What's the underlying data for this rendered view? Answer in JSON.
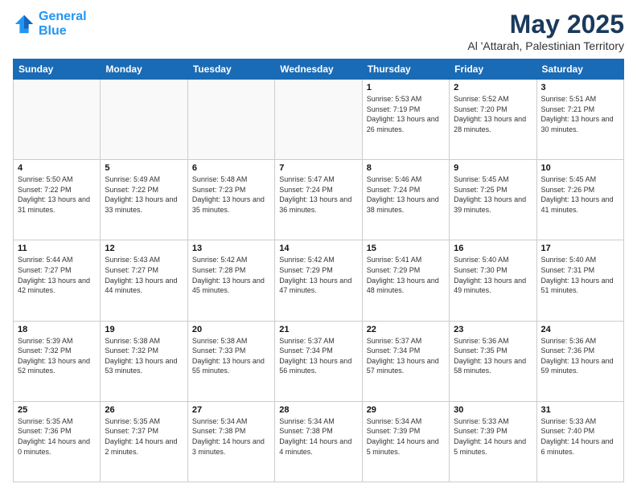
{
  "header": {
    "logo_line1": "General",
    "logo_line2": "Blue",
    "month": "May 2025",
    "location": "Al 'Attarah, Palestinian Territory"
  },
  "weekdays": [
    "Sunday",
    "Monday",
    "Tuesday",
    "Wednesday",
    "Thursday",
    "Friday",
    "Saturday"
  ],
  "weeks": [
    [
      {
        "day": "",
        "sunrise": "",
        "sunset": "",
        "daylight": ""
      },
      {
        "day": "",
        "sunrise": "",
        "sunset": "",
        "daylight": ""
      },
      {
        "day": "",
        "sunrise": "",
        "sunset": "",
        "daylight": ""
      },
      {
        "day": "",
        "sunrise": "",
        "sunset": "",
        "daylight": ""
      },
      {
        "day": "1",
        "sunrise": "Sunrise: 5:53 AM",
        "sunset": "Sunset: 7:19 PM",
        "daylight": "Daylight: 13 hours and 26 minutes."
      },
      {
        "day": "2",
        "sunrise": "Sunrise: 5:52 AM",
        "sunset": "Sunset: 7:20 PM",
        "daylight": "Daylight: 13 hours and 28 minutes."
      },
      {
        "day": "3",
        "sunrise": "Sunrise: 5:51 AM",
        "sunset": "Sunset: 7:21 PM",
        "daylight": "Daylight: 13 hours and 30 minutes."
      }
    ],
    [
      {
        "day": "4",
        "sunrise": "Sunrise: 5:50 AM",
        "sunset": "Sunset: 7:22 PM",
        "daylight": "Daylight: 13 hours and 31 minutes."
      },
      {
        "day": "5",
        "sunrise": "Sunrise: 5:49 AM",
        "sunset": "Sunset: 7:22 PM",
        "daylight": "Daylight: 13 hours and 33 minutes."
      },
      {
        "day": "6",
        "sunrise": "Sunrise: 5:48 AM",
        "sunset": "Sunset: 7:23 PM",
        "daylight": "Daylight: 13 hours and 35 minutes."
      },
      {
        "day": "7",
        "sunrise": "Sunrise: 5:47 AM",
        "sunset": "Sunset: 7:24 PM",
        "daylight": "Daylight: 13 hours and 36 minutes."
      },
      {
        "day": "8",
        "sunrise": "Sunrise: 5:46 AM",
        "sunset": "Sunset: 7:24 PM",
        "daylight": "Daylight: 13 hours and 38 minutes."
      },
      {
        "day": "9",
        "sunrise": "Sunrise: 5:45 AM",
        "sunset": "Sunset: 7:25 PM",
        "daylight": "Daylight: 13 hours and 39 minutes."
      },
      {
        "day": "10",
        "sunrise": "Sunrise: 5:45 AM",
        "sunset": "Sunset: 7:26 PM",
        "daylight": "Daylight: 13 hours and 41 minutes."
      }
    ],
    [
      {
        "day": "11",
        "sunrise": "Sunrise: 5:44 AM",
        "sunset": "Sunset: 7:27 PM",
        "daylight": "Daylight: 13 hours and 42 minutes."
      },
      {
        "day": "12",
        "sunrise": "Sunrise: 5:43 AM",
        "sunset": "Sunset: 7:27 PM",
        "daylight": "Daylight: 13 hours and 44 minutes."
      },
      {
        "day": "13",
        "sunrise": "Sunrise: 5:42 AM",
        "sunset": "Sunset: 7:28 PM",
        "daylight": "Daylight: 13 hours and 45 minutes."
      },
      {
        "day": "14",
        "sunrise": "Sunrise: 5:42 AM",
        "sunset": "Sunset: 7:29 PM",
        "daylight": "Daylight: 13 hours and 47 minutes."
      },
      {
        "day": "15",
        "sunrise": "Sunrise: 5:41 AM",
        "sunset": "Sunset: 7:29 PM",
        "daylight": "Daylight: 13 hours and 48 minutes."
      },
      {
        "day": "16",
        "sunrise": "Sunrise: 5:40 AM",
        "sunset": "Sunset: 7:30 PM",
        "daylight": "Daylight: 13 hours and 49 minutes."
      },
      {
        "day": "17",
        "sunrise": "Sunrise: 5:40 AM",
        "sunset": "Sunset: 7:31 PM",
        "daylight": "Daylight: 13 hours and 51 minutes."
      }
    ],
    [
      {
        "day": "18",
        "sunrise": "Sunrise: 5:39 AM",
        "sunset": "Sunset: 7:32 PM",
        "daylight": "Daylight: 13 hours and 52 minutes."
      },
      {
        "day": "19",
        "sunrise": "Sunrise: 5:38 AM",
        "sunset": "Sunset: 7:32 PM",
        "daylight": "Daylight: 13 hours and 53 minutes."
      },
      {
        "day": "20",
        "sunrise": "Sunrise: 5:38 AM",
        "sunset": "Sunset: 7:33 PM",
        "daylight": "Daylight: 13 hours and 55 minutes."
      },
      {
        "day": "21",
        "sunrise": "Sunrise: 5:37 AM",
        "sunset": "Sunset: 7:34 PM",
        "daylight": "Daylight: 13 hours and 56 minutes."
      },
      {
        "day": "22",
        "sunrise": "Sunrise: 5:37 AM",
        "sunset": "Sunset: 7:34 PM",
        "daylight": "Daylight: 13 hours and 57 minutes."
      },
      {
        "day": "23",
        "sunrise": "Sunrise: 5:36 AM",
        "sunset": "Sunset: 7:35 PM",
        "daylight": "Daylight: 13 hours and 58 minutes."
      },
      {
        "day": "24",
        "sunrise": "Sunrise: 5:36 AM",
        "sunset": "Sunset: 7:36 PM",
        "daylight": "Daylight: 13 hours and 59 minutes."
      }
    ],
    [
      {
        "day": "25",
        "sunrise": "Sunrise: 5:35 AM",
        "sunset": "Sunset: 7:36 PM",
        "daylight": "Daylight: 14 hours and 0 minutes."
      },
      {
        "day": "26",
        "sunrise": "Sunrise: 5:35 AM",
        "sunset": "Sunset: 7:37 PM",
        "daylight": "Daylight: 14 hours and 2 minutes."
      },
      {
        "day": "27",
        "sunrise": "Sunrise: 5:34 AM",
        "sunset": "Sunset: 7:38 PM",
        "daylight": "Daylight: 14 hours and 3 minutes."
      },
      {
        "day": "28",
        "sunrise": "Sunrise: 5:34 AM",
        "sunset": "Sunset: 7:38 PM",
        "daylight": "Daylight: 14 hours and 4 minutes."
      },
      {
        "day": "29",
        "sunrise": "Sunrise: 5:34 AM",
        "sunset": "Sunset: 7:39 PM",
        "daylight": "Daylight: 14 hours and 5 minutes."
      },
      {
        "day": "30",
        "sunrise": "Sunrise: 5:33 AM",
        "sunset": "Sunset: 7:39 PM",
        "daylight": "Daylight: 14 hours and 5 minutes."
      },
      {
        "day": "31",
        "sunrise": "Sunrise: 5:33 AM",
        "sunset": "Sunset: 7:40 PM",
        "daylight": "Daylight: 14 hours and 6 minutes."
      }
    ]
  ]
}
